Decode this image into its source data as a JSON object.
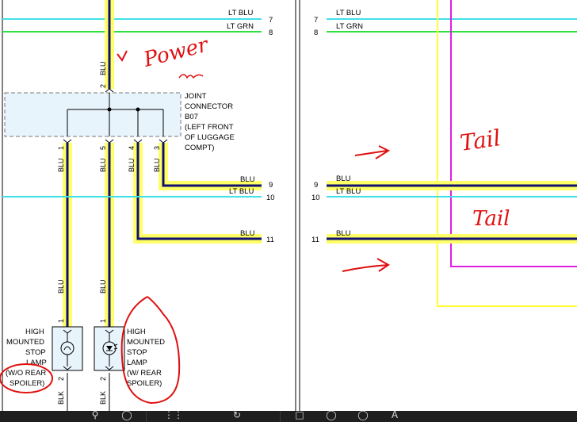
{
  "left_panel": {
    "wires_top": [
      {
        "color_label": "LT BLU",
        "pin": "7"
      },
      {
        "color_label": "LT GRN",
        "pin": "8"
      }
    ],
    "feed_wire": {
      "color_label": "BLU",
      "pin": "2"
    },
    "joint_connector_lines": [
      "JOINT",
      "CONNECTOR",
      "B07",
      "(LEFT FRONT",
      "OF LUGGAGE",
      "COMPT)"
    ],
    "branches": [
      {
        "pin": "1",
        "color_label": "BLU"
      },
      {
        "pin": "5",
        "color_label": "BLU"
      },
      {
        "pin": "4",
        "color_label": "BLU"
      },
      {
        "pin": "3",
        "color_label": "BLU"
      }
    ],
    "wires_mid": [
      {
        "color_label": "BLU",
        "pin": "9"
      },
      {
        "color_label": "LT BLU",
        "pin": "10"
      },
      {
        "color_label": "BLU",
        "pin": "11"
      }
    ],
    "lamp_feed_labels": [
      "BLU",
      "BLU"
    ],
    "lamp_pins_top": [
      "1",
      "1"
    ],
    "lamp_pins_bottom": [
      "2",
      "2"
    ],
    "ground_labels": [
      "BLK",
      "BLK"
    ],
    "lamp_left_lines": [
      "HIGH",
      "MOUNTED",
      "STOP",
      "LAMP",
      "(W/O REAR",
      "SPOILER)"
    ],
    "lamp_right_lines": [
      "HIGH",
      "MOUNTED",
      "STOP",
      "LAMP",
      "(W/ REAR",
      "SPOILER)"
    ]
  },
  "right_panel": {
    "wires": [
      {
        "color_label": "LT BLU",
        "pin": "7"
      },
      {
        "color_label": "LT GRN",
        "pin": "8"
      },
      {
        "color_label": "BLU",
        "pin": "9"
      },
      {
        "color_label": "LT BLU",
        "pin": "10"
      },
      {
        "color_label": "BLU",
        "pin": "11"
      }
    ]
  },
  "annotations": {
    "power": "Power",
    "tail_1": "Tail",
    "tail_2": "Tail"
  },
  "colors": {
    "blu_wire": "#101070",
    "highlight": "#ffff66",
    "lt_blu": "#40e0e8",
    "lt_grn": "#30e040",
    "magenta": "#e020e0",
    "annotation": "#e01010",
    "connector_fill": "#e8f4fc"
  },
  "toolbar": {
    "buttons": [
      "search-icon",
      "person-icon",
      "grid-icon",
      "rotate-icon",
      "page-icon",
      "zoom-in-icon",
      "zoom-out-icon",
      "text-icon"
    ]
  }
}
